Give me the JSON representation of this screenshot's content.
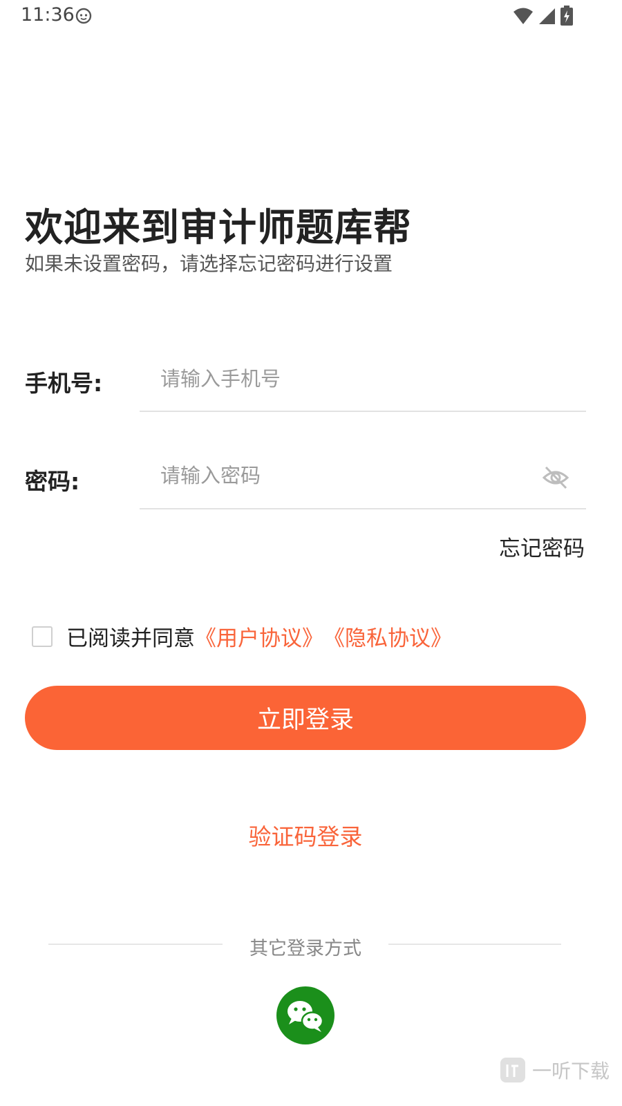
{
  "status_bar": {
    "time": "11:36"
  },
  "welcome": {
    "title": "欢迎来到审计师题库帮",
    "subtitle": "如果未设置密码，请选择忘记密码进行设置"
  },
  "phone_field": {
    "label": "手机号:",
    "placeholder": "请输入手机号",
    "value": ""
  },
  "password_field": {
    "label": "密码:",
    "placeholder": "请输入密码",
    "value": ""
  },
  "forgot_password": "忘记密码",
  "agreement": {
    "prefix": "已阅读并同意",
    "user_agreement": "《用户协议》",
    "privacy_agreement": "《隐私协议》"
  },
  "login_button": "立即登录",
  "code_login": "验证码登录",
  "other_login": {
    "label": "其它登录方式"
  },
  "watermark": {
    "text": "一听下载"
  },
  "colors": {
    "accent": "#fb6436",
    "link": "#f9643a",
    "wechat": "#1b8f1b"
  },
  "icons": [
    "app-notification-icon",
    "wifi-icon",
    "signal-icon",
    "battery-charging-icon",
    "eye-off-icon",
    "wechat-icon",
    "watermark-logo-icon"
  ]
}
